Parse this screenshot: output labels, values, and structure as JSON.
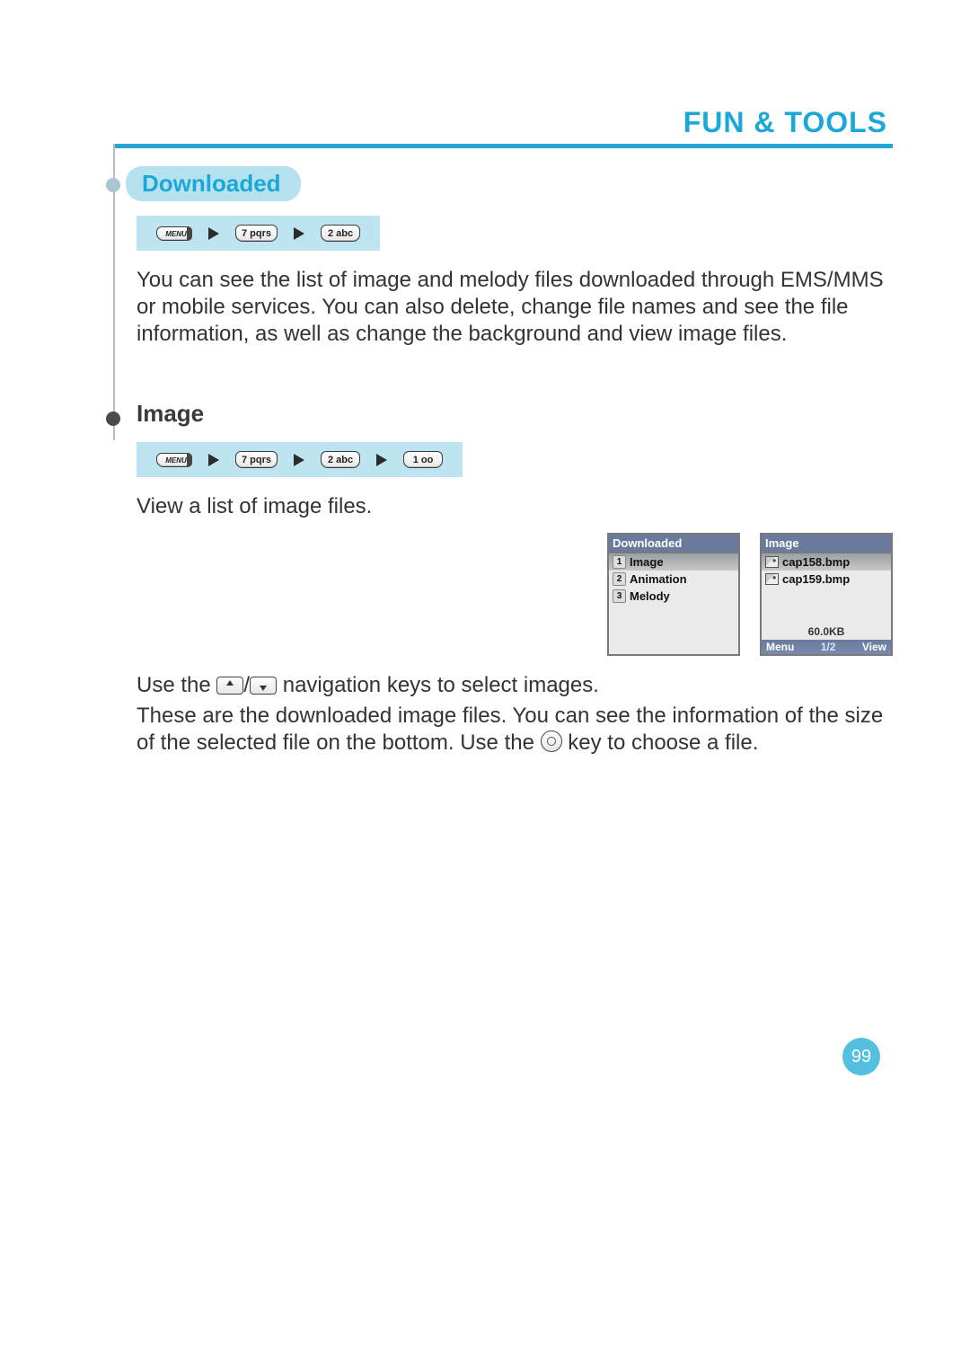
{
  "header": {
    "title": "FUN & TOOLS"
  },
  "section1": {
    "heading": "Downloaded",
    "keys": [
      "MENU",
      "7 pqrs",
      "2 abc"
    ],
    "body": "You can see the list of image and melody files downloaded through EMS/MMS or mobile services. You can also delete, change file names and see the file information, as well as change the background and view image files."
  },
  "section2": {
    "heading": "Image",
    "keys": [
      "MENU",
      "7 pqrs",
      "2 abc",
      "1 oo"
    ],
    "intro": "View a list of image files.",
    "screens": {
      "left": {
        "title": "Downloaded",
        "items": [
          {
            "n": "1",
            "label": "Image",
            "selected": true
          },
          {
            "n": "2",
            "label": "Animation",
            "selected": false
          },
          {
            "n": "3",
            "label": "Melody",
            "selected": false
          }
        ]
      },
      "right": {
        "title": "Image",
        "files": [
          {
            "name": "cap158.bmp",
            "selected": true
          },
          {
            "name": "cap159.bmp",
            "selected": false
          }
        ],
        "size": "60.0KB",
        "soft": {
          "left": "Menu",
          "mid": "1/2",
          "right": "View"
        }
      }
    },
    "tail1a": "Use the ",
    "tail1b": " navigation keys to select images.",
    "tail2a": "These are the downloaded image files. You can see the information of the size of the selected file on the bottom. Use the ",
    "tail2b": " key to choose a file."
  },
  "page_number": "99"
}
